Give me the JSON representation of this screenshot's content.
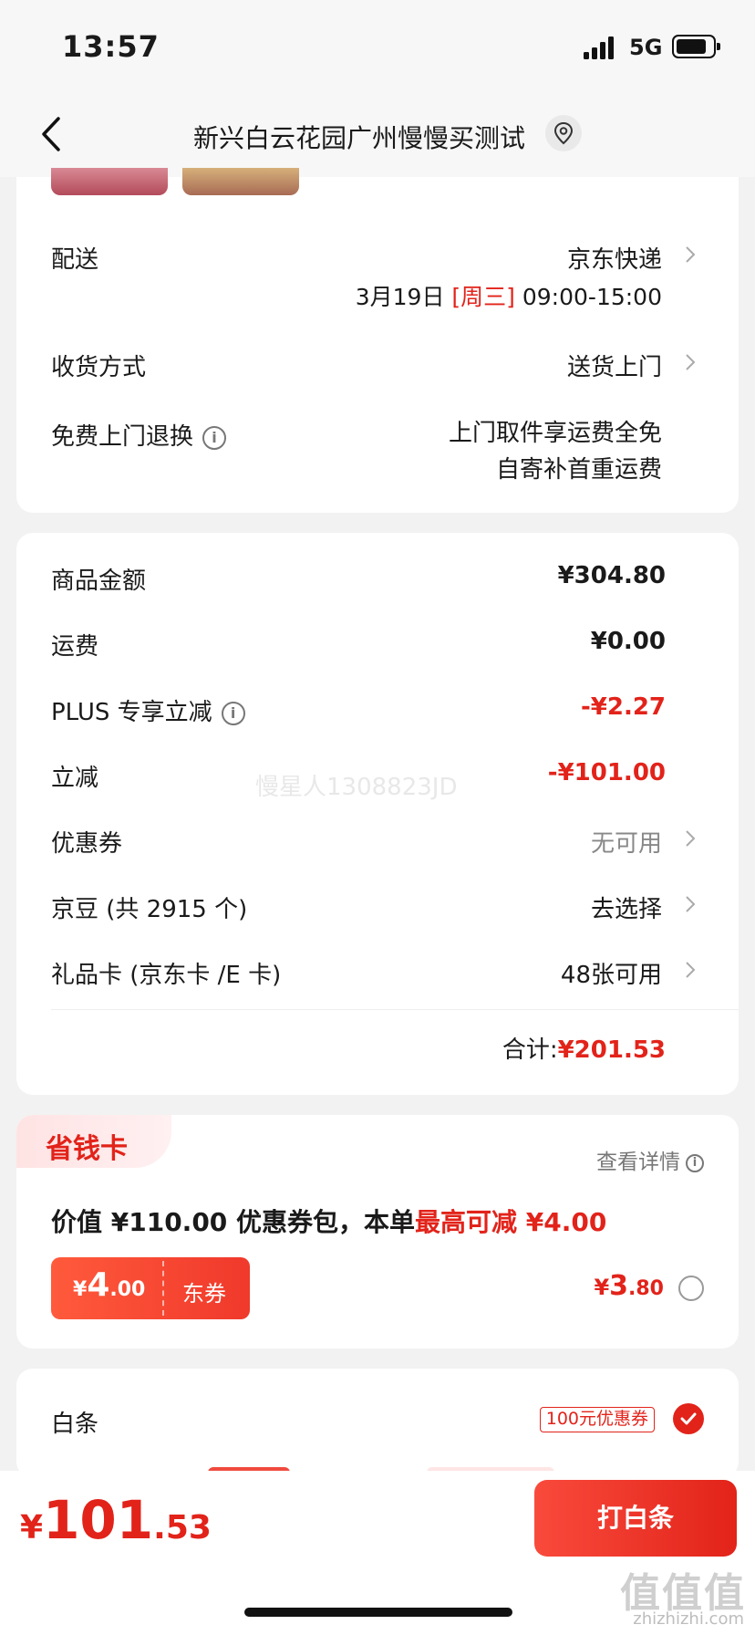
{
  "status_bar": {
    "time": "13:57",
    "network": "5G"
  },
  "header": {
    "title": "新兴白云花园广州慢慢买测试"
  },
  "delivery": {
    "delivery_label": "配送",
    "delivery_value": "京东快递",
    "date": "3月19日",
    "weekday": "[周三]",
    "time_window": "09:00-15:00",
    "receive_label": "收货方式",
    "receive_value": "送货上门",
    "return_label": "免费上门退换",
    "return_line1": "上门取件享运费全免",
    "return_line2": "自寄补首重运费"
  },
  "price_details": {
    "goods_label": "商品金额",
    "goods_value": "¥304.80",
    "shipping_label": "运费",
    "shipping_value": "¥0.00",
    "plus_label": "PLUS 专享立减",
    "plus_value": "-¥2.27",
    "discount_label": "立减",
    "discount_value": "-¥101.00",
    "coupon_label": "优惠券",
    "coupon_value": "无可用",
    "jingdou_label": "京豆 (共 2915 个)",
    "jingdou_value": "去选择",
    "giftcard_label": "礼品卡 (京东卡 /E 卡)",
    "giftcard_value": "48张可用",
    "total_label": "合计:",
    "total_value": "¥201.53",
    "watermark": "慢星人1308823JD"
  },
  "saving_card": {
    "title": "省钱卡",
    "detail_link": "查看详情",
    "desc_prefix": "价值 ¥110.00 优惠券包，本单",
    "desc_highlight": "最高可减 ¥4.00",
    "coupon_currency": "¥",
    "coupon_amount_int": "4",
    "coupon_amount_dec": ".00",
    "coupon_type": "东券",
    "price_currency": "¥",
    "price_int": "3",
    "price_dec": ".80"
  },
  "baitiao": {
    "label": "白条",
    "badge": "100元优惠券",
    "checked": true
  },
  "bottom": {
    "total_currency": "¥",
    "total_int": "101",
    "total_dec": ".53",
    "pay_button": "打白条",
    "watermark_site": "值值值",
    "watermark_url": "zhizhizhi.com"
  },
  "colors": {
    "accent": "#e2231a",
    "background": "#f2f2f2"
  },
  "icons": [
    "back-arrow-icon",
    "location-pin-icon",
    "chevron-right-icon",
    "info-icon",
    "check-icon"
  ]
}
